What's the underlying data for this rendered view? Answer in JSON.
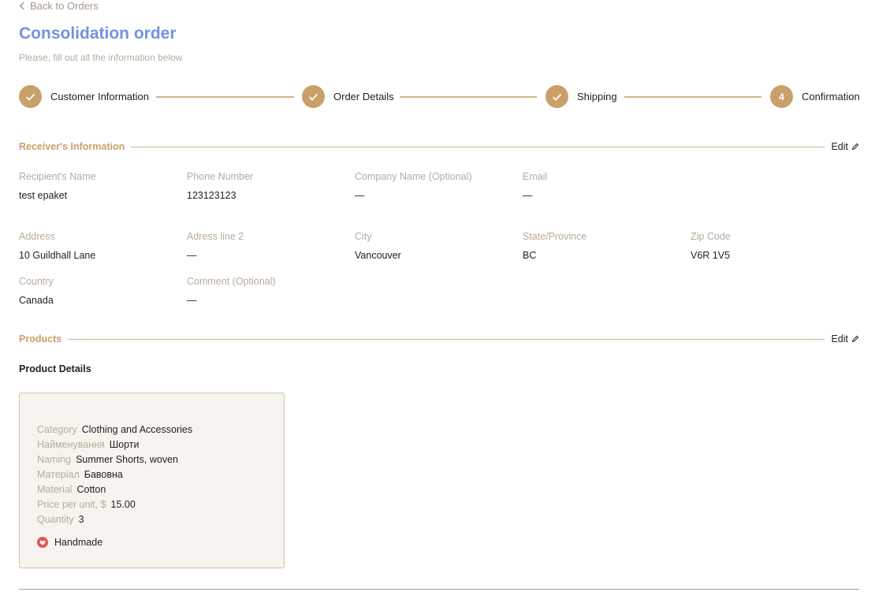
{
  "nav": {
    "back_label": "Back to Orders"
  },
  "header": {
    "title": "Consolidation order",
    "subtitle": "Please, fill out all the information below"
  },
  "stepper": {
    "steps": [
      {
        "label": "Customer Information",
        "state": "done"
      },
      {
        "label": "Order Details",
        "state": "done"
      },
      {
        "label": "Shipping",
        "state": "done"
      },
      {
        "label": "Confirmation",
        "state": "current",
        "number": "4"
      }
    ]
  },
  "receiver": {
    "section_title": "Receiver's Information",
    "edit_label": "Edit",
    "fields": {
      "recipient_name": {
        "label": "Recipient's Name",
        "value": "test epaket"
      },
      "phone": {
        "label": "Phone Number",
        "value": "123123123"
      },
      "company": {
        "label": "Company Name (Optional)",
        "value": "—"
      },
      "email": {
        "label": "Email",
        "value": "—"
      },
      "address": {
        "label": "Address",
        "value": "10 Guildhall Lane"
      },
      "address2": {
        "label": "Adress line 2",
        "value": "—"
      },
      "city": {
        "label": "City",
        "value": "Vancouver"
      },
      "state": {
        "label": "State/Province",
        "value": "BC"
      },
      "zip": {
        "label": "Zip Code",
        "value": "V6R 1V5"
      },
      "country": {
        "label": "Country",
        "value": "Canada"
      },
      "comment": {
        "label": "Comment (Optional)",
        "value": "—"
      }
    }
  },
  "products": {
    "section_title": "Products",
    "edit_label": "Edit",
    "details_title": "Product Details",
    "items": [
      {
        "rows": [
          {
            "key": "Category",
            "value": "Clothing and Accessories"
          },
          {
            "key": "Найменування",
            "value": "Шорти"
          },
          {
            "key": "Naming",
            "value": "Summer Shorts, woven"
          },
          {
            "key": "Матеріал",
            "value": "Бавовна"
          },
          {
            "key": "Material",
            "value": "Cotton"
          },
          {
            "key": "Price per unit, $",
            "value": "15.00"
          },
          {
            "key": "Quantity",
            "value": "3"
          }
        ],
        "badge": "Handmade"
      }
    ]
  },
  "colors": {
    "accent": "#c9a06a",
    "title": "#7094e0",
    "muted": "#b8aa9c",
    "card_bg": "#f7f3ee",
    "badge": "#e05757"
  },
  "icons": {
    "back": "chevron-left-icon",
    "step_done": "check-icon",
    "edit": "pencil-icon",
    "handmade": "heart-icon"
  }
}
